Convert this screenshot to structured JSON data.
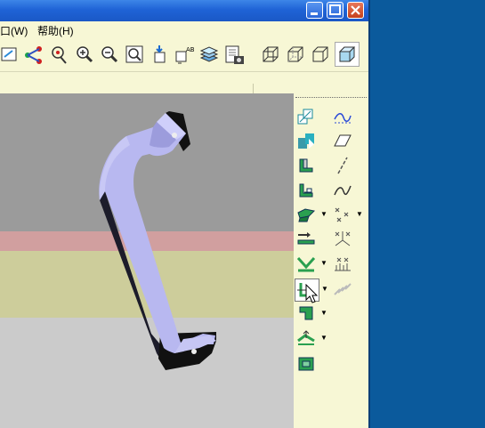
{
  "window": {
    "menu": [
      {
        "label": "口(W)",
        "id": "window"
      },
      {
        "label": "帮助(H)",
        "id": "help"
      }
    ],
    "title_buttons": [
      "minimize",
      "maximize",
      "close"
    ]
  },
  "toolbar": {
    "tools": [
      "redraw-icon",
      "datum-display-icon",
      "spin-center-icon",
      "zoom-in-icon",
      "zoom-out-icon",
      "refit-icon",
      "reorient-icon",
      "named-views-icon",
      "layers-icon",
      "model-display-icon",
      "wireframe-icon",
      "hidden-line-icon",
      "no-hidden-icon",
      "shading-icon"
    ]
  },
  "feature_toolbar": {
    "left": [
      "copy-icon",
      "merge-icon",
      "wall-icon",
      "flange-icon",
      "bend-icon",
      "unbend-icon",
      "bend-back-icon",
      "edge-rip-icon",
      "rip-connect-icon",
      "form-icon",
      "corner-relief-icon",
      "flatten-icon"
    ],
    "right": [
      "sketch-icon",
      "plane-icon",
      "axis-icon",
      "curve-icon",
      "point-icon",
      "csys-icon",
      "analysis-icon",
      "datum-grid-icon"
    ]
  },
  "colors": {
    "accent": "#1f63d6",
    "part": "#b8b8f0",
    "viewport_top": "#9b9b9b",
    "viewport_pink": "#d19f9f",
    "viewport_yellow": "#cdcd9b",
    "viewport_bottom": "#cbcbcb",
    "desktop": "#0b5a9c"
  }
}
